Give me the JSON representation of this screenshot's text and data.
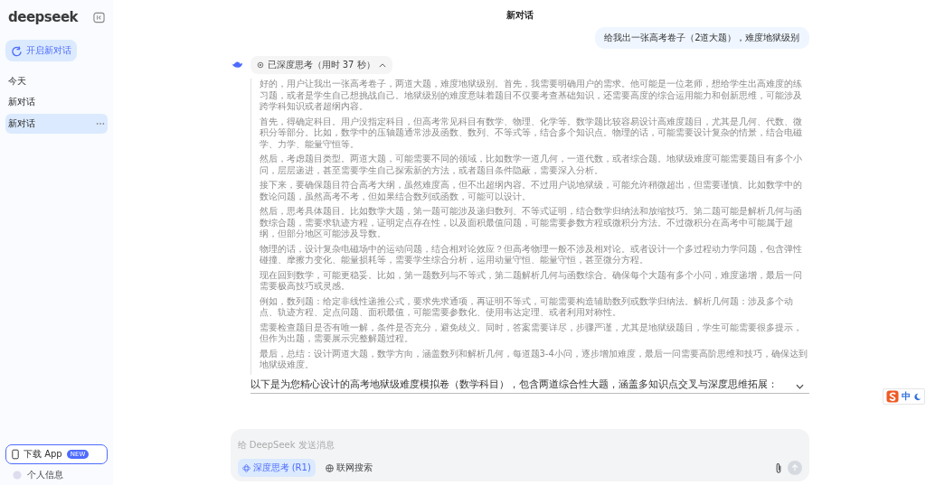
{
  "sidebar": {
    "logo": "deepseek",
    "new_chat": "开启新对话",
    "section_label": "今天",
    "chats": [
      {
        "title": "新对话",
        "selected": false
      },
      {
        "title": "新对话",
        "selected": true
      }
    ],
    "download": {
      "label": "下载 App",
      "badge": "NEW"
    },
    "profile": "个人信息"
  },
  "header": {
    "title": "新对话"
  },
  "user_message": "给我出一张高考卷子（2道大题），难度地狱级别",
  "thinking": {
    "label": "已深度思考（用时 37 秒）",
    "expanded": true,
    "paragraphs": [
      "好的，用户让我出一张高考卷子，两道大题，难度地狱级别。首先，我需要明确用户的需求。他可能是一位老师，想给学生出高难度的练习题，或者是学生自己想挑战自己。地狱级别的难度意味着题目不仅要考查基础知识，还需要高度的综合运用能力和创新思维，可能涉及跨学科知识或者超纲内容。",
      "首先，得确定科目。用户没指定科目，但高考常见科目有数学、物理、化学等。数学题比较容易设计高难度题目，尤其是几何、代数、微积分等部分。比如，数学中的压轴题通常涉及函数、数列、不等式等，结合多个知识点。物理的话，可能需要设计复杂的情景，结合电磁学、力学、能量守恒等。",
      "然后，考虑题目类型。两道大题，可能需要不同的领域，比如数学一道几何，一道代数，或者综合题。地狱级难度可能需要题目有多个小问，层层递进，甚至需要学生自己探索新的方法，或者题目条件隐蔽，需要深入分析。",
      "接下来，要确保题目符合高考大纲，虽然难度高，但不出超纲内容。不过用户说地狱级，可能允许稍微超出，但需要谨慎。比如数学中的数论问题，虽然高考不考，但如果结合数列或函数，可能可以设计。",
      "然后，思考具体题目。比如数学大题，第一题可能涉及递归数列、不等式证明，结合数学归纳法和放缩技巧。第二题可能是解析几何与函数综合题，需要求轨迹方程，证明定点存在性，以及面积最值问题，可能需要参数方程或微积分方法。不过微积分在高考中可能属于超纲，但部分地区可能涉及导数。",
      "物理的话，设计复杂电磁场中的运动问题，结合相对论效应？但高考物理一般不涉及相对论。或者设计一个多过程动力学问题，包含弹性碰撞、摩擦力变化、能量损耗等，需要学生综合分析，运用动量守恒、能量守恒，甚至微分方程。",
      "现在回到数学，可能更稳妥。比如，第一题数列与不等式，第二题解析几何与函数综合。确保每个大题有多个小问，难度递增，最后一问需要极高技巧或灵感。",
      "例如，数列题：给定非线性递推公式，要求先求通项，再证明不等式，可能需要构造辅助数列或数学归纳法。解析几何题：涉及多个动点、轨迹方程、定点问题、面积最值，可能需要参数化、使用韦达定理、或者利用对称性。",
      "需要检查题目是否有唯一解，条件是否充分，避免歧义。同时，答案需要详尽，步骤严谨，尤其是地狱级题目，学生可能需要很多提示，但作为出题，需要展示完整解题过程。",
      "最后，总结：设计两道大题，数学方向，涵盖数列和解析几何，每道题3-4小问，逐步增加难度，最后一问需要高阶思维和技巧，确保达到地狱级难度。"
    ]
  },
  "answer": "以下是为您精心设计的高考地狱级难度模拟卷（数学科目），包含两道综合性大题，涵盖多知识点交叉与深度思维拓展：",
  "composer": {
    "placeholder": "给 DeepSeek 发送消息",
    "toggles": [
      {
        "kind": "deep_think",
        "label": "深度思考 (R1)",
        "selected": true
      },
      {
        "kind": "web_search",
        "label": "联网搜索",
        "selected": false
      }
    ]
  },
  "ime": {
    "mode": "中"
  }
}
